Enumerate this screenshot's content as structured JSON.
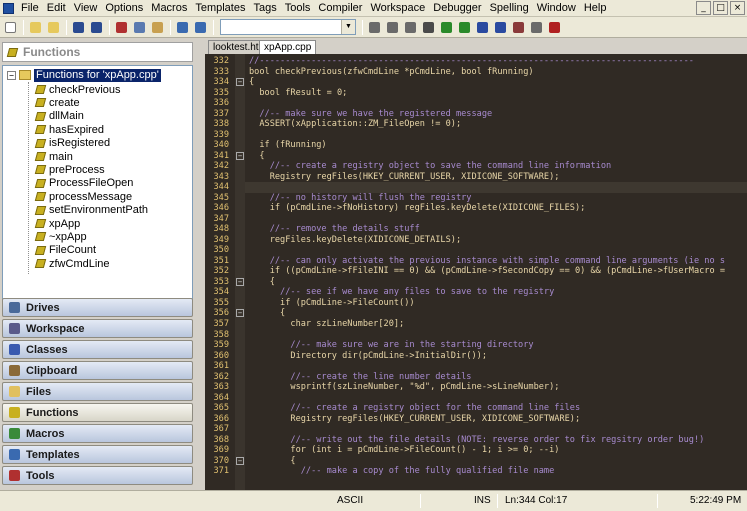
{
  "menubar": {
    "items": [
      "File",
      "Edit",
      "View",
      "Options",
      "Macros",
      "Templates",
      "Tags",
      "Tools",
      "Compiler",
      "Workspace",
      "Debugger",
      "Spelling",
      "Window",
      "Help"
    ]
  },
  "toolbar": {
    "combo_value": "",
    "icons": [
      "new-file-icon",
      "open-folder-icon",
      "open-folder-alt-icon",
      "save-icon",
      "save-all-icon",
      "cut-icon",
      "copy-icon",
      "paste-icon",
      "undo-icon",
      "redo-icon",
      "find-icon",
      "find-files-icon",
      "replace-icon",
      "print-icon",
      "arrow-up-icon",
      "arrow-down-icon",
      "arrow-left-icon",
      "arrow-right-icon",
      "compile-icon",
      "grep-icon",
      "help-icon"
    ]
  },
  "functions_panel": {
    "title": "Functions",
    "root_label": "Functions for 'xpApp.cpp'",
    "items": [
      "checkPrevious",
      "create",
      "dllMain",
      "hasExpired",
      "isRegistered",
      "main",
      "preProcess",
      "ProcessFileOpen",
      "processMessage",
      "setEnvironmentPath",
      "xpApp",
      "~xpApp",
      "FileCount",
      "zfwCmdLine"
    ]
  },
  "nav_buttons": [
    {
      "label": "Drives",
      "icon": "drives-icon",
      "color": "#4a6a9a"
    },
    {
      "label": "Workspace",
      "icon": "workspace-icon",
      "color": "#5a5a8a"
    },
    {
      "label": "Classes",
      "icon": "classes-icon",
      "color": "#3a5ab0"
    },
    {
      "label": "Clipboard",
      "icon": "clipboard-icon",
      "color": "#8a6a3a"
    },
    {
      "label": "Files",
      "icon": "files-icon",
      "color": "#e0c060"
    },
    {
      "label": "Functions",
      "icon": "functions-icon",
      "color": "#c8b020"
    },
    {
      "label": "Macros",
      "icon": "macros-icon",
      "color": "#3a8a3a"
    },
    {
      "label": "Templates",
      "icon": "templates-icon",
      "color": "#3a6ab0"
    },
    {
      "label": "Tools",
      "icon": "tools-icon",
      "color": "#b03030"
    }
  ],
  "active_nav": "Functions",
  "tabs": [
    {
      "label": "looktest.html",
      "active": false
    },
    {
      "label": "xpApp.cpp",
      "active": true
    }
  ],
  "editor": {
    "current_line": 344,
    "lines": [
      {
        "n": "332",
        "text": "//------------------------------------------------------------------------------------",
        "cls": "cmt",
        "fold": ""
      },
      {
        "n": "333",
        "text": "bool checkPrevious(zfwCmdLine *pCmdLine, bool fRunning)",
        "cls": "",
        "fold": ""
      },
      {
        "n": "334",
        "text": "{",
        "cls": "",
        "fold": "−"
      },
      {
        "n": "335",
        "text": "  bool fResult = 0;",
        "cls": "",
        "fold": ""
      },
      {
        "n": "336",
        "text": "",
        "cls": "",
        "fold": ""
      },
      {
        "n": "337",
        "text": "  //-- make sure we have the registered message",
        "cls": "cmt",
        "fold": ""
      },
      {
        "n": "338",
        "text": "  ASSERT(xApplication::ZM_FileOpen != 0);",
        "cls": "",
        "fold": ""
      },
      {
        "n": "339",
        "text": "",
        "cls": "",
        "fold": ""
      },
      {
        "n": "340",
        "text": "  if (fRunning)",
        "cls": "",
        "fold": ""
      },
      {
        "n": "341",
        "text": "  {",
        "cls": "",
        "fold": "−"
      },
      {
        "n": "342",
        "text": "    //-- create a registry object to save the command line information",
        "cls": "cmt",
        "fold": ""
      },
      {
        "n": "343",
        "text": "    Registry regFiles(HKEY_CURRENT_USER, XIDICONE_SOFTWARE);",
        "cls": "",
        "fold": ""
      },
      {
        "n": "344",
        "text": "",
        "cls": "",
        "fold": ""
      },
      {
        "n": "345",
        "text": "    //-- no history will flush the registry",
        "cls": "cmt",
        "fold": ""
      },
      {
        "n": "346",
        "text": "    if (pCmdLine->fNoHistory) regFiles.keyDelete(XIDICONE_FILES);",
        "cls": "",
        "fold": ""
      },
      {
        "n": "347",
        "text": "",
        "cls": "",
        "fold": ""
      },
      {
        "n": "348",
        "text": "    //-- remove the details stuff",
        "cls": "cmt",
        "fold": ""
      },
      {
        "n": "349",
        "text": "    regFiles.keyDelete(XIDICONE_DETAILS);",
        "cls": "",
        "fold": ""
      },
      {
        "n": "350",
        "text": "",
        "cls": "",
        "fold": ""
      },
      {
        "n": "351",
        "text": "    //-- can only activate the previous instance with simple command line arguments (ie no s",
        "cls": "cmt",
        "fold": ""
      },
      {
        "n": "352",
        "text": "    if ((pCmdLine->fFileINI == 0) && (pCmdLine->fSecondCopy == 0) && (pCmdLine->fUserMacro =",
        "cls": "",
        "fold": ""
      },
      {
        "n": "353",
        "text": "    {",
        "cls": "",
        "fold": "−"
      },
      {
        "n": "354",
        "text": "      //-- see if we have any files to save to the registry",
        "cls": "cmt",
        "fold": ""
      },
      {
        "n": "355",
        "text": "      if (pCmdLine->FileCount())",
        "cls": "",
        "fold": ""
      },
      {
        "n": "356",
        "text": "      {",
        "cls": "",
        "fold": "−"
      },
      {
        "n": "357",
        "text": "        char szLineNumber[20];",
        "cls": "",
        "fold": ""
      },
      {
        "n": "358",
        "text": "",
        "cls": "",
        "fold": ""
      },
      {
        "n": "359",
        "text": "        //-- make sure we are in the starting directory",
        "cls": "cmt",
        "fold": ""
      },
      {
        "n": "360",
        "text": "        Directory dir(pCmdLine->InitialDir());",
        "cls": "",
        "fold": ""
      },
      {
        "n": "361",
        "text": "",
        "cls": "",
        "fold": ""
      },
      {
        "n": "362",
        "text": "        //-- create the line number details",
        "cls": "cmt",
        "fold": ""
      },
      {
        "n": "363",
        "text": "        wsprintf(szLineNumber, \"%d\", pCmdLine->sLineNumber);",
        "cls": "",
        "fold": ""
      },
      {
        "n": "364",
        "text": "",
        "cls": "",
        "fold": ""
      },
      {
        "n": "365",
        "text": "        //-- create a registry object for the command line files",
        "cls": "cmt",
        "fold": ""
      },
      {
        "n": "366",
        "text": "        Registry regFiles(HKEY_CURRENT_USER, XIDICONE_SOFTWARE);",
        "cls": "",
        "fold": ""
      },
      {
        "n": "367",
        "text": "",
        "cls": "",
        "fold": ""
      },
      {
        "n": "368",
        "text": "        //-- write out the file details (NOTE: reverse order to fix regsitry order bug!)",
        "cls": "cmt",
        "fold": ""
      },
      {
        "n": "369",
        "text": "        for (int i = pCmdLine->FileCount() - 1; i >= 0; --i)",
        "cls": "",
        "fold": ""
      },
      {
        "n": "370",
        "text": "        {",
        "cls": "",
        "fold": "−"
      },
      {
        "n": "371",
        "text": "          //-- make a copy of the fully qualified file name",
        "cls": "cmt",
        "fold": ""
      }
    ]
  },
  "statusbar": {
    "encoding": "ASCII",
    "mode": "INS",
    "position": "Ln:344 Col:17",
    "time": "5:22:49 PM"
  }
}
